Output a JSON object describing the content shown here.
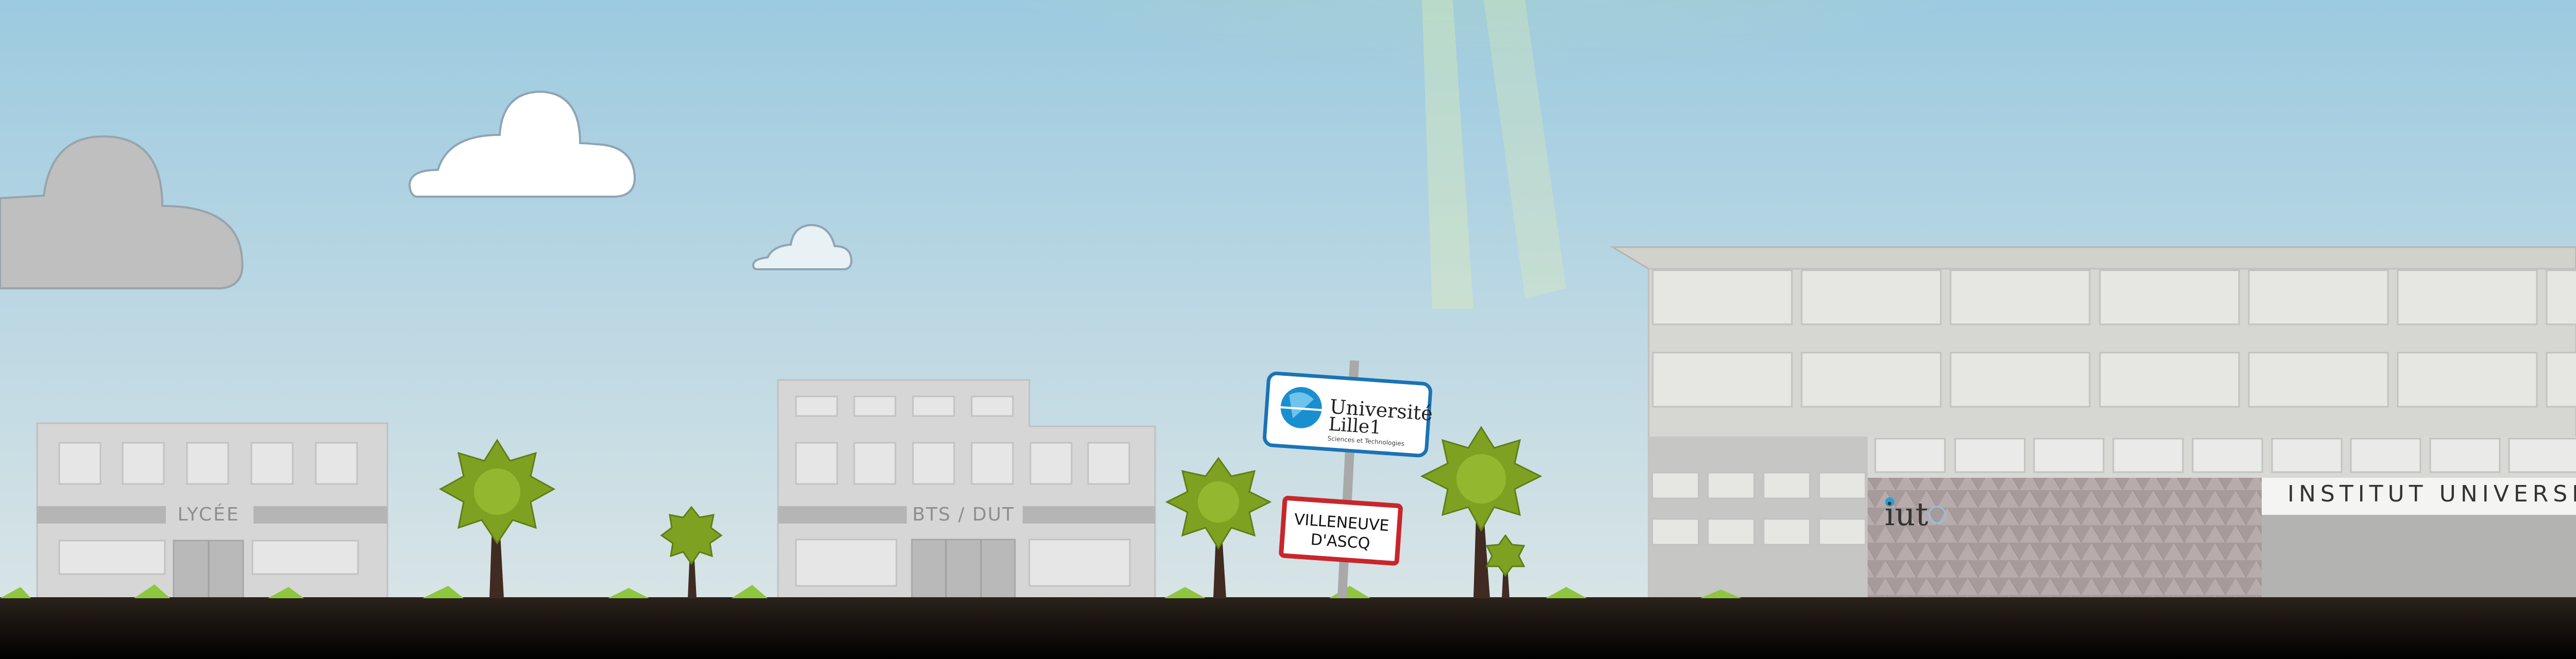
{
  "buildings": {
    "lycee": {
      "label": "LYCÉE"
    },
    "bts_dut": {
      "label": "BTS / DUT"
    },
    "iut": {
      "label": "INSTITUT UNIVERSITAIRE",
      "logo_text": "iut"
    }
  },
  "signs": {
    "university": {
      "line1": "Université",
      "line2": "Lille1",
      "line3": "Sciences et Technologies"
    },
    "city": {
      "line1": "VILLENEUVE",
      "line2": "D'ASCQ"
    }
  },
  "colors": {
    "sky_top": "#9fcbe0",
    "sky_bottom": "#d6e3e7",
    "sun": "#d9ec8a",
    "ground": "#231c17",
    "building": "#d6d6d6",
    "building_dark": "#b3b3b3",
    "window": "#e9e9e9",
    "tree_leaf": "#8aaa2a",
    "tree_trunk": "#3f2b21",
    "grass": "#8ec63f",
    "uni_blue": "#1a73b5",
    "sign_red": "#c8262b"
  },
  "icons": {
    "university_logo": "globe-icon",
    "iut_logo": "iut-logo-icon"
  }
}
